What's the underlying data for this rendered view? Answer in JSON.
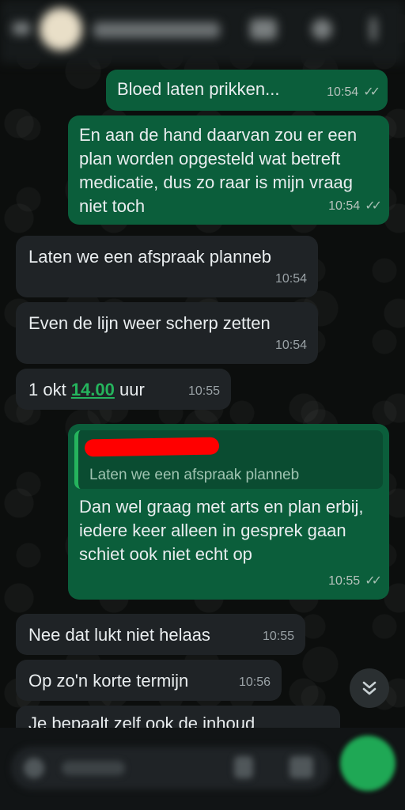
{
  "messages": [
    {
      "text": "Bloed laten prikken...",
      "time": "10:54"
    },
    {
      "text": "En aan de hand daarvan zou er een plan worden opgesteld wat betreft medicatie, dus zo raar is mijn vraag niet toch",
      "time": "10:54"
    },
    {
      "text": "Laten we een afspraak planneb",
      "time": "10:54"
    },
    {
      "text": "Even de lijn weer scherp zetten",
      "time": "10:54"
    },
    {
      "prefix": "1 okt ",
      "link": "14.00",
      "suffix": " uur",
      "time": "10:55"
    },
    {
      "quoted": "Laten we een afspraak planneb",
      "text": "Dan wel graag met arts en plan erbij, iedere keer alleen in gesprek gaan schiet ook niet echt op",
      "time": "10:55"
    },
    {
      "text": "Nee dat lukt niet helaas",
      "time": "10:55"
    },
    {
      "text": "Op zo'n korte termijn",
      "time": "10:56"
    },
    {
      "text": "Je bepaalt zelf ook de inhoud"
    }
  ],
  "ticks": "✓✓",
  "colors": {
    "outgoing": "#0b5e3b",
    "incoming": "#1f2326",
    "accent": "#25b45d"
  }
}
